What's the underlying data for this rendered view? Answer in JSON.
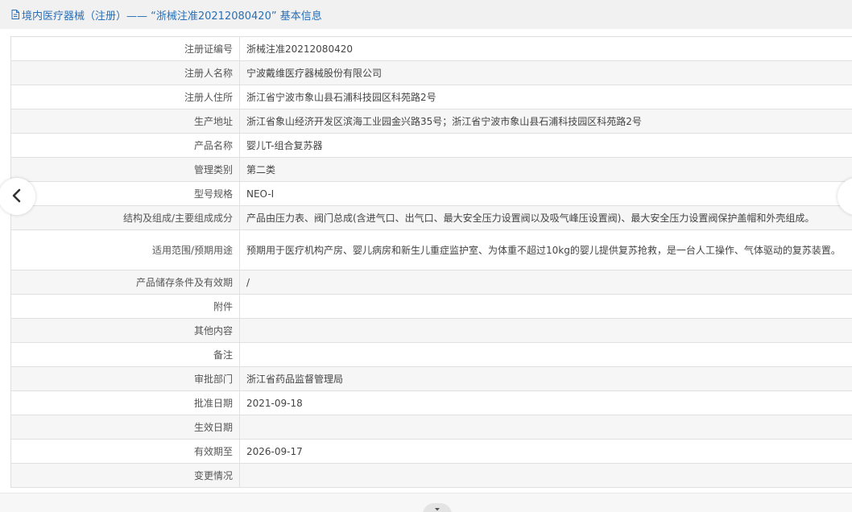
{
  "header": {
    "title": "境内医疗器械（注册）——  “浙械注准20212080420” 基本信息",
    "icon": "document-icon"
  },
  "rows": [
    {
      "label": "注册证编号",
      "value": "浙械注准20212080420"
    },
    {
      "label": "注册人名称",
      "value": "宁波戴维医疗器械股份有限公司"
    },
    {
      "label": "注册人住所",
      "value": "浙江省宁波市象山县石浦科技园区科苑路2号"
    },
    {
      "label": "生产地址",
      "value": "浙江省象山经济开发区滨海工业园金兴路35号；浙江省宁波市象山县石浦科技园区科苑路2号"
    },
    {
      "label": "产品名称",
      "value": "婴儿T-组合复苏器"
    },
    {
      "label": "管理类别",
      "value": "第二类"
    },
    {
      "label": "型号规格",
      "value": "NEO-Ⅰ"
    },
    {
      "label": "结构及组成/主要组成成分",
      "value": "产品由压力表、阀门总成(含进气口、出气口、最大安全压力设置阀以及吸气峰压设置阀)、最大安全压力设置阀保护盖帽和外壳组成。"
    },
    {
      "label": "适用范围/预期用途",
      "value": "预期用于医疗机构产房、婴儿病房和新生儿重症监护室、为体重不超过10kg的婴儿提供复苏抢救，是一台人工操作、气体驱动的复苏装置。"
    },
    {
      "label": "产品储存条件及有效期",
      "value": "/"
    },
    {
      "label": "附件",
      "value": ""
    },
    {
      "label": "其他内容",
      "value": ""
    },
    {
      "label": "备注",
      "value": ""
    },
    {
      "label": "审批部门",
      "value": "浙江省药品监督管理局"
    },
    {
      "label": "批准日期",
      "value": "2021-09-18"
    },
    {
      "label": "生效日期",
      "value": ""
    },
    {
      "label": "有效期至",
      "value": "2026-09-17"
    },
    {
      "label": "变更情况",
      "value": ""
    }
  ],
  "nav": {
    "prev_icon": "chevron-left-icon",
    "next_icon": "chevron-right-icon",
    "scroll_icon": "caret-down-icon"
  },
  "colors": {
    "title": "#2a6fb6",
    "header_bg": "#f1f1f1",
    "row_shade": "#f6f6f6",
    "border": "#e0e0e0"
  }
}
